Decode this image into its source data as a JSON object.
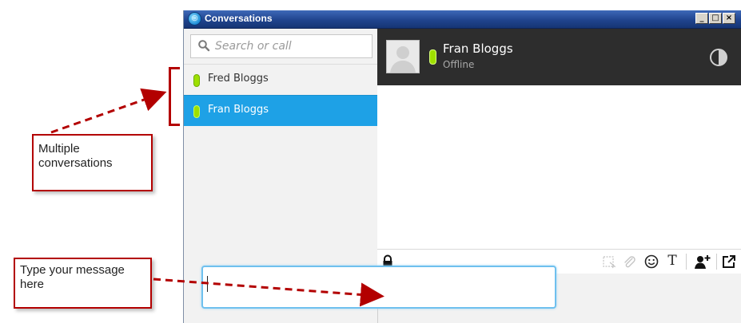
{
  "window": {
    "title": "Conversations",
    "controls": {
      "minimize": "_",
      "maximize": "□",
      "close": "×"
    }
  },
  "search": {
    "placeholder": "Search or call"
  },
  "conversations": [
    {
      "name": "Fred Bloggs",
      "selected": false,
      "status_color": "#9ee000"
    },
    {
      "name": "Fran Bloggs",
      "selected": true,
      "status_color": "#9ee000"
    }
  ],
  "contact": {
    "name": "Fran Bloggs",
    "status": "Offline"
  },
  "toolbar": {
    "icons": [
      "lock-icon",
      "screenshot-icon",
      "attach-icon",
      "emoticon-icon",
      "text-format-icon",
      "add-person-icon",
      "popout-icon"
    ],
    "text_format_glyph": "T"
  },
  "message": {
    "value": ""
  },
  "annotations": {
    "conversations_note": "Multiple conversations",
    "message_note": "Type your message here"
  },
  "colors": {
    "accent": "#1ea1e6",
    "status_online": "#9ee000",
    "annotation": "#b30000",
    "header_bg": "#2d2d2d"
  }
}
